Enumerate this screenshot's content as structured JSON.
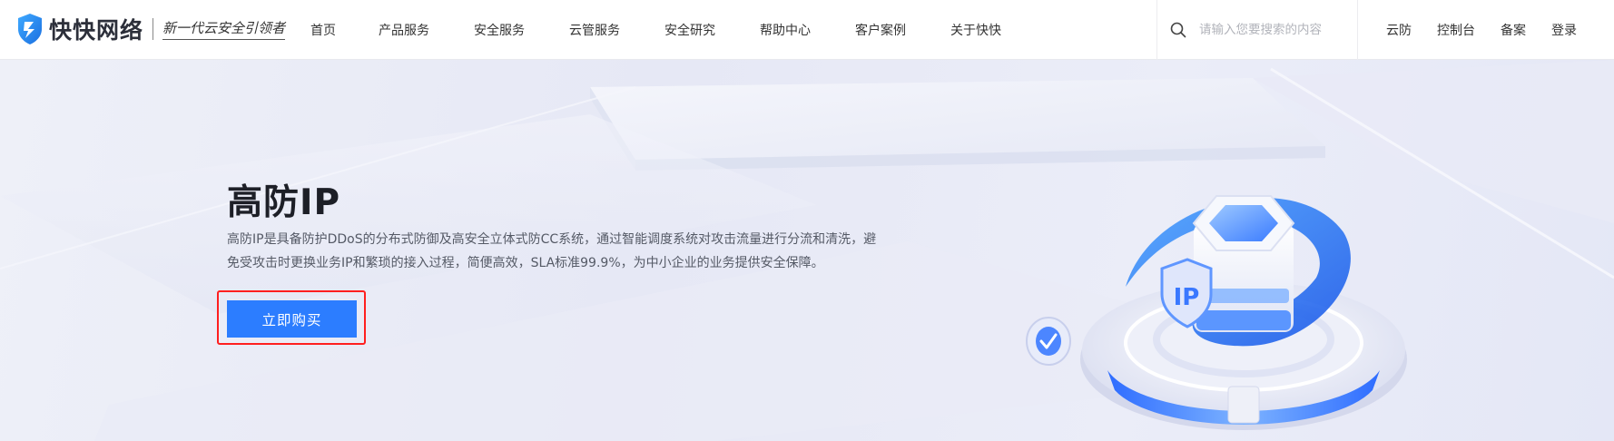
{
  "header": {
    "logo": {
      "name": "快快网络",
      "slogan": "新一代云安全引领者",
      "icon": "shield-logo-icon"
    },
    "nav_items": [
      {
        "label": "首页"
      },
      {
        "label": "产品服务"
      },
      {
        "label": "安全服务"
      },
      {
        "label": "云管服务"
      },
      {
        "label": "安全研究"
      },
      {
        "label": "帮助中心"
      },
      {
        "label": "客户案例"
      },
      {
        "label": "关于快快"
      }
    ],
    "search": {
      "placeholder": "请输入您要搜索的内容",
      "value": "",
      "icon": "search-icon"
    },
    "right_links": [
      {
        "label": "云防"
      },
      {
        "label": "控制台"
      },
      {
        "label": "备案"
      },
      {
        "label": "登录"
      }
    ]
  },
  "banner": {
    "title": "高防IP",
    "description": "高防IP是具备防护DDoS的分布式防御及高安全立体式防CC系统，通过智能调度系统对攻击流量进行分流和清洗，避免受攻击时更换业务IP和繁琐的接入过程，简便高效，SLA标准99.9%，为中小企业的业务提供安全保障。",
    "buy_button_label": "立即购买",
    "illustration": {
      "badge_text": "IP",
      "icons": [
        "shield-ip-icon",
        "check-badge-icon"
      ]
    }
  },
  "colors": {
    "accent": "#2c7dff",
    "highlight_border": "#ff1f1f",
    "banner_bg": "#eceef8",
    "title_text": "#1d1f27",
    "body_text": "#555a66"
  }
}
